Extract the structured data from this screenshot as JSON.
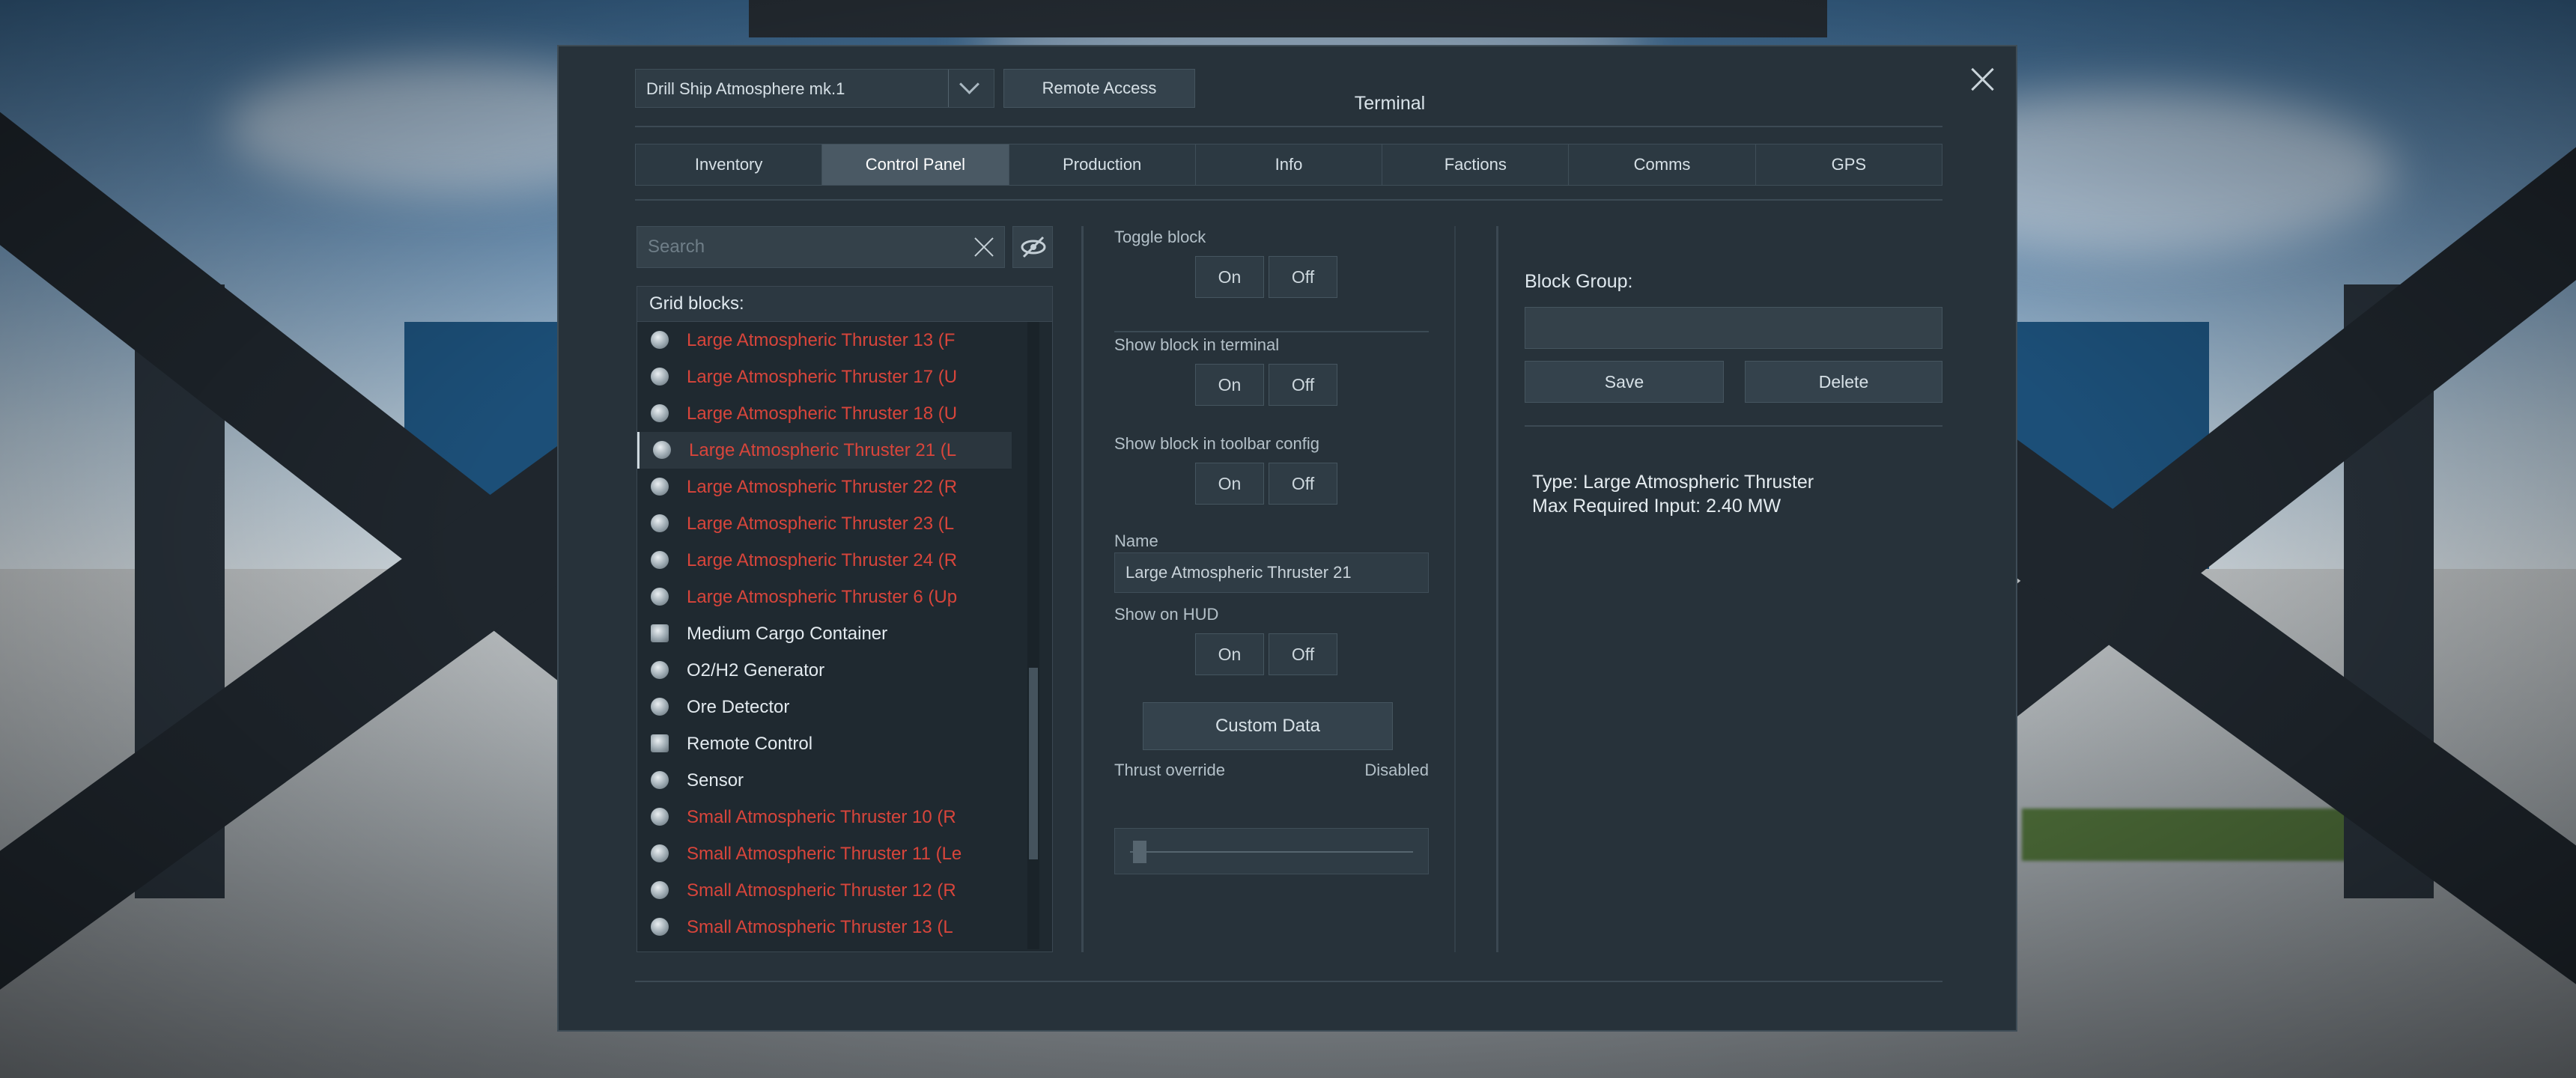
{
  "window": {
    "title": "Terminal",
    "grid_name": "Drill Ship Atmosphere mk.1",
    "remote_access": "Remote Access"
  },
  "tabs": [
    {
      "label": "Inventory"
    },
    {
      "label": "Control Panel",
      "active": true
    },
    {
      "label": "Production"
    },
    {
      "label": "Info"
    },
    {
      "label": "Factions"
    },
    {
      "label": "Comms"
    },
    {
      "label": "GPS"
    }
  ],
  "search": {
    "placeholder": "Search"
  },
  "grid_blocks": {
    "header": "Grid blocks:",
    "items": [
      {
        "label": "Large Atmospheric Thruster 13 (F",
        "status": "red"
      },
      {
        "label": "Large Atmospheric Thruster 17 (U",
        "status": "red"
      },
      {
        "label": "Large Atmospheric Thruster 18 (U",
        "status": "red"
      },
      {
        "label": "Large Atmospheric Thruster 21 (L",
        "status": "red",
        "selected": true
      },
      {
        "label": "Large Atmospheric Thruster 22 (R",
        "status": "red"
      },
      {
        "label": "Large Atmospheric Thruster 23 (L",
        "status": "red"
      },
      {
        "label": "Large Atmospheric Thruster 24 (R",
        "status": "red"
      },
      {
        "label": "Large Atmospheric Thruster 6 (Up",
        "status": "red"
      },
      {
        "label": "Medium Cargo Container",
        "status": "white"
      },
      {
        "label": "O2/H2 Generator",
        "status": "white"
      },
      {
        "label": "Ore Detector",
        "status": "white"
      },
      {
        "label": "Remote Control",
        "status": "white"
      },
      {
        "label": "Sensor",
        "status": "white"
      },
      {
        "label": "Small Atmospheric Thruster 10 (R",
        "status": "red"
      },
      {
        "label": "Small Atmospheric Thruster 11 (Le",
        "status": "red"
      },
      {
        "label": "Small Atmospheric Thruster 12 (R",
        "status": "red"
      },
      {
        "label": "Small Atmospheric Thruster 13 (L",
        "status": "red"
      }
    ]
  },
  "controls": {
    "on": "On",
    "off": "Off",
    "toggle_block": "Toggle block",
    "show_in_terminal": "Show block in terminal",
    "show_in_toolbar": "Show block in toolbar config",
    "name_label": "Name",
    "name_value": "Large Atmospheric Thruster 21",
    "show_on_hud": "Show on HUD",
    "custom_data": "Custom Data",
    "thrust_override": "Thrust override",
    "thrust_value": "Disabled"
  },
  "block_group": {
    "label": "Block Group:",
    "save": "Save",
    "delete": "Delete"
  },
  "info": {
    "type": "Type: Large Atmospheric Thruster",
    "max_input": "Max Required Input: 2.40 MW"
  }
}
